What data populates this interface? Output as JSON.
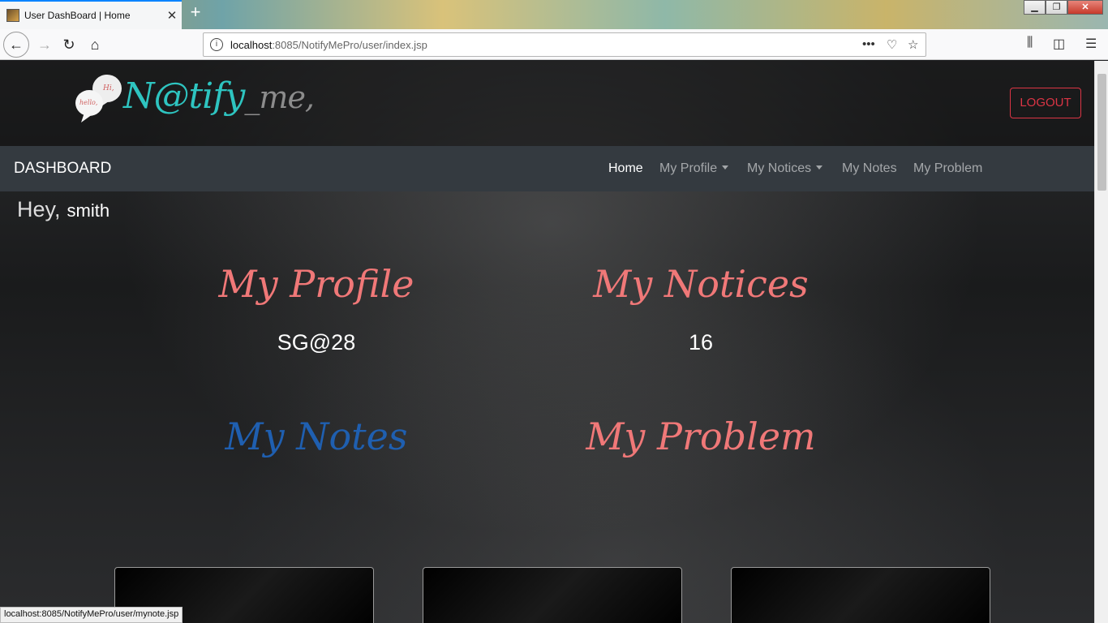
{
  "browser": {
    "tab_title": "User DashBoard | Home",
    "tab_close": "✕",
    "new_tab": "+",
    "url_host": "localhost",
    "url_rest": ":8085/NotifyMePro/user/index.jsp",
    "status_url": "localhost:8085/NotifyMePro/user/mynote.jsp"
  },
  "header": {
    "logo_main": "N@tify",
    "logo_sub": "_me,",
    "bubble_top": "Hi,",
    "bubble_left": "hello,",
    "logout_label": "LOGOUT"
  },
  "nav": {
    "brand": "DASHBOARD",
    "items": [
      {
        "label": "Home"
      },
      {
        "label": "My Profile"
      },
      {
        "label": "My Notices"
      },
      {
        "label": "My Notes"
      },
      {
        "label": "My Problem"
      }
    ]
  },
  "greeting": {
    "prefix": "Hey,",
    "user": "smith"
  },
  "cards": [
    {
      "title": "My Profile",
      "value": "SG@28",
      "color": "#f07878"
    },
    {
      "title": "My Notices",
      "value": "16",
      "color": "#f07878"
    },
    {
      "title": "My Notes",
      "value": "",
      "color": "#1f5fb0"
    },
    {
      "title": "My Problem",
      "value": "",
      "color": "#f07878"
    }
  ],
  "icons": {
    "back": "back-arrow-icon",
    "forward": "forward-arrow-icon",
    "reload": "reload-icon",
    "home": "home-icon",
    "info": "info-icon",
    "more": "more-icon",
    "pocket": "pocket-icon",
    "bookmark": "star-icon",
    "library": "library-icon",
    "sidebar": "sidebar-icon",
    "menu": "menu-icon"
  }
}
